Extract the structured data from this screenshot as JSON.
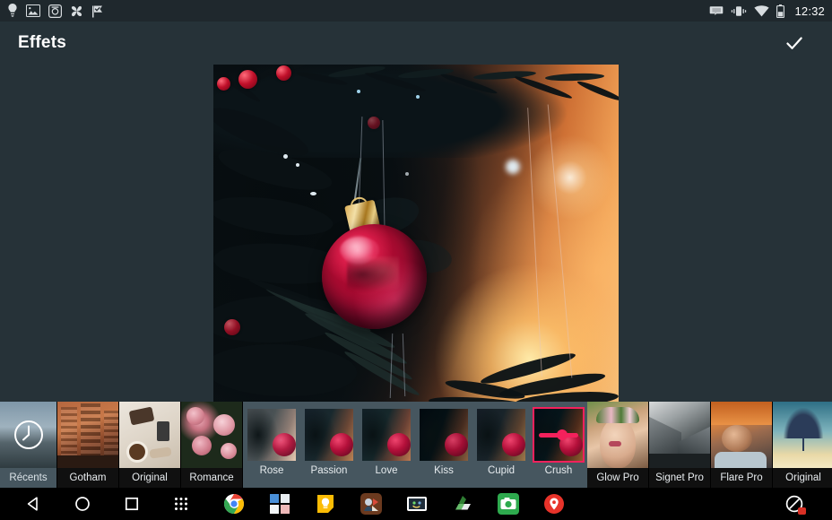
{
  "statusbar": {
    "time": "12:32",
    "left_icons": [
      "lightbulb-icon",
      "photo-icon",
      "screenshot-camera-icon",
      "pinwheel-photos-icon",
      "check-flag-icon"
    ],
    "right_icons": [
      "cast-screen-icon",
      "vibrate-icon",
      "wifi-icon",
      "battery-icon"
    ]
  },
  "appbar": {
    "title": "Effets",
    "confirm_label": "check-icon"
  },
  "canvas": {
    "image_alt": "Red glass Christmas ornament hanging on a fir branch with warm bokeh lights"
  },
  "filters": {
    "packs_left": [
      {
        "label": "Récents",
        "icon": "clock-icon",
        "selected": true
      },
      {
        "label": "Gotham",
        "icon": "",
        "selected": false
      },
      {
        "label": "Original",
        "icon": "",
        "selected": false
      },
      {
        "label": "Romance",
        "icon": "",
        "selected": false
      }
    ],
    "presets": [
      {
        "label": "Rose",
        "selected": false
      },
      {
        "label": "Passion",
        "selected": false
      },
      {
        "label": "Love",
        "selected": false
      },
      {
        "label": "Kiss",
        "selected": false
      },
      {
        "label": "Cupid",
        "selected": false
      },
      {
        "label": "Crush",
        "selected": true,
        "slider_value": 60
      }
    ],
    "packs_right": [
      {
        "label": "Glow Pro",
        "selected": false
      },
      {
        "label": "Signet Pro",
        "selected": false
      },
      {
        "label": "Flare Pro",
        "selected": false
      },
      {
        "label": "Original",
        "selected": false
      }
    ],
    "accent_color": "#f4215c",
    "strip_background": "#46565f"
  },
  "navbar": {
    "system_buttons": [
      "back-icon",
      "home-icon",
      "recents-icon",
      "app-drawer-icon"
    ],
    "tray_apps": [
      "chrome-icon",
      "windows-grid-icon",
      "keep-notes-icon",
      "game-icon",
      "photo-viewer-icon",
      "drive-icon",
      "camera-icon",
      "maps-alert-icon"
    ],
    "right_status": "do-not-disturb-icon"
  },
  "colors": {
    "status_bar": "#1f282d",
    "app_bar": "#263238",
    "canvas_bg": "#263238",
    "nav_bg": "#000000",
    "accent": "#f4215c"
  }
}
